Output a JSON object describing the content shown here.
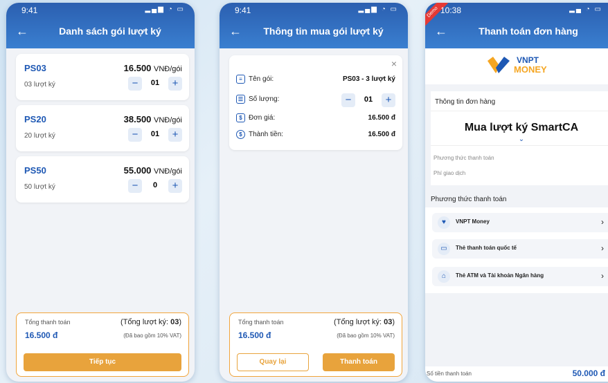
{
  "screen1": {
    "status_time": "9:41",
    "status_icons": "▂▄▆ ◔ ▭",
    "back": "←",
    "title": "Danh sách gói lượt ký",
    "packages": [
      {
        "code": "PS03",
        "price": "16.500",
        "unit": "VNĐ/gói",
        "count": "03 lượt ký",
        "qty": "01"
      },
      {
        "code": "PS20",
        "price": "38.500",
        "unit": "VNĐ/gói",
        "count": "20 lượt ký",
        "qty": "01"
      },
      {
        "code": "PS50",
        "price": "55.000",
        "unit": "VNĐ/gói",
        "count": "50 lượt ký",
        "qty": "0"
      }
    ],
    "footer": {
      "total_label": "Tổng thanh toán",
      "total_count_prefix": "(Tổng lượt ký: ",
      "total_count": "03",
      "total_count_suffix": ")",
      "amount": "16.500 đ",
      "vat_note": "(Đã bao gồm 10% VAT)",
      "continue_label": "Tiếp tục"
    }
  },
  "screen2": {
    "status_time": "9:41",
    "status_icons": "▂▄▆ ◔ ▭",
    "back": "←",
    "title": "Thông tin mua gói lượt ký",
    "close": "×",
    "rows": {
      "name_label": "Tên gói:",
      "name_value": "PS03 - 3 lượt ký",
      "qty_label": "Số lượng:",
      "qty_value": "01",
      "price_label": "Đơn giá:",
      "price_value": "16.500 đ",
      "total_label": "Thành tiền:",
      "total_value": "16.500 đ"
    },
    "footer": {
      "total_label": "Tổng thanh toán",
      "total_count_prefix": "(Tổng lượt ký: ",
      "total_count": "03",
      "total_count_suffix": ")",
      "amount": "16.500 đ",
      "vat_note": "(Đã bao gồm 10% VAT)",
      "back_label": "Quay lại",
      "pay_label": "Thanh toán"
    }
  },
  "screen3": {
    "badge": "Demo",
    "status_time": "10:38",
    "status_icons": "▂▄ ◔ ▭",
    "back": "←",
    "title": "Thanh toán đơn hàng",
    "logo_line1": "VNPT",
    "logo_line2": "MONEY",
    "order_header": "Thông tin đơn hàng",
    "order_title": "Mua lượt ký SmartCA",
    "method_label": "Phương thức thanh toán",
    "fee_label": "Phí giao dịch",
    "methods_header": "Phương thức thanh toán",
    "methods": [
      {
        "label": "VNPT Money",
        "icon": "vnpt-money-icon"
      },
      {
        "label": "Thẻ thanh toán quốc tế",
        "icon": "credit-card-icon"
      },
      {
        "label": "Thẻ ATM và Tài khoản Ngân hàng",
        "icon": "bank-icon"
      }
    ],
    "amount_label": "Số tiền thanh toán",
    "amount_value": "50.000 đ"
  },
  "colors": {
    "primary": "#1e58b4",
    "accent": "#e8a33c",
    "header": "#2b5fb0"
  }
}
